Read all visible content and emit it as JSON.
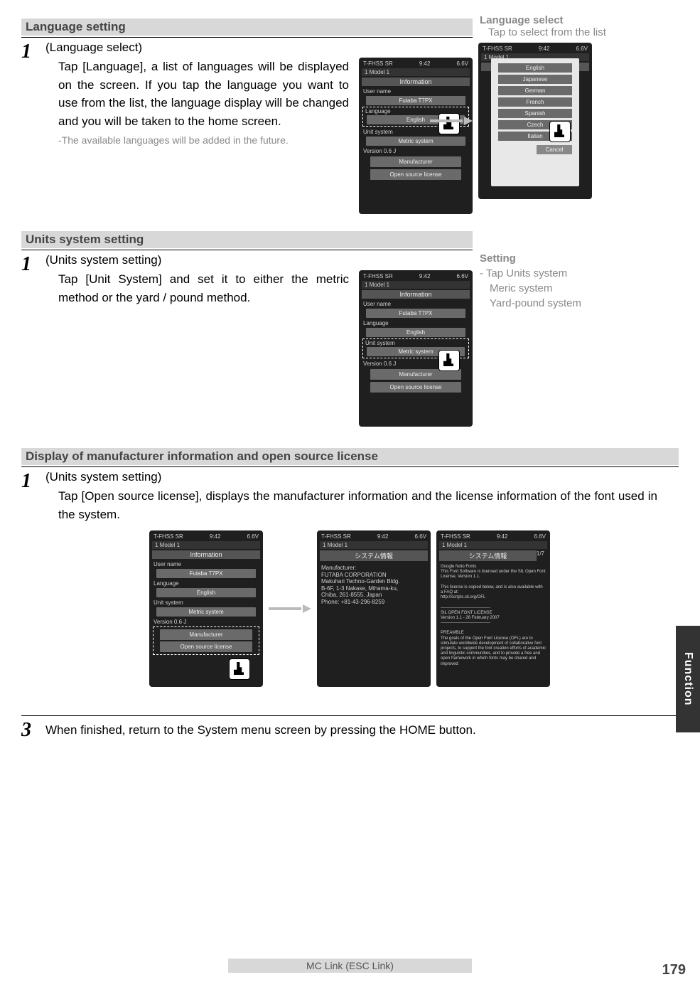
{
  "sections": {
    "lang_setting_heading": "Language setting",
    "units_setting_heading": "Units system setting",
    "manu_heading": "Display of manufacturer information and open source license"
  },
  "lang": {
    "step_num": "1",
    "step_title": "(Language select)",
    "step_text": "Tap [Language], a list of languages will be displayed on the screen. If you tap the language you want to use from the list, the language display will be changed and you will be taken to the home screen.",
    "step_note": "-The available languages will be added in the future.",
    "side_heading": "Language select",
    "side_sub": "Tap to select from the list"
  },
  "units": {
    "step_num": "1",
    "step_title": "(Units system setting)",
    "step_text": "Tap [Unit System] and set it to either the metric method or the yard / pound method.",
    "side_title": "Setting",
    "side_l1": "- Tap Units system",
    "side_l2": "Meric system",
    "side_l3": "Yard-pound system"
  },
  "manu": {
    "step_num": "1",
    "step_title": "(Units system setting)",
    "step_text": "Tap [Open source license], displays the manufacturer information and the license information of the font used in the system."
  },
  "final": {
    "step_num": "3",
    "step_text": "When finished, return to the System menu screen by pressing the HOME button."
  },
  "screen_common": {
    "status_left": "T-FHSS SR",
    "status_mid": "9:42",
    "status_right": "6.6V",
    "model": "1    Model 1",
    "info_title": "Information",
    "user_name_label": "User name",
    "user_name_value": "Futaba T7PX",
    "language_label": "Language",
    "language_value": "English",
    "unit_label": "Unit system",
    "unit_value": "Metric system",
    "version_label": "Version     0.6 J",
    "manufacturer_btn": "Manufacturer",
    "opensource_btn": "Open source license"
  },
  "lang_popup": {
    "options": [
      "English",
      "Japanese",
      "German",
      "French",
      "Spanish",
      "Czech",
      "Italian"
    ],
    "cancel": "Cancel"
  },
  "manu_screen": {
    "title_jp": "システム情報",
    "body": "Manufacturer:\nFUTABA CORPORATION\nMakuhari Techno-Garden Bldg.\nB-6F, 1-3 Nakase, Mihama-ku,\nChiba, 261-8555, Japan\nPhone: +81-43-296-8259"
  },
  "lic_screen": {
    "title_jp": "システム情報",
    "page": "1/7",
    "body": "Google Noto Fonts\nThis Font Software is licensed under the SIL Open Font License, Version 1.1.\n\nThis license is copied below, and is also available with a FAQ at:\nhttp://scripts.sil.org/OFL\n\n-----------------------------------\nSIL OPEN FONT LICENSE\nVersion 1.1 - 26 February 2007\n-----------------------------------\n\nPREAMBLE\nThe goals of the Open Font License (OFL) are to stimulate worldwide development of collaborative font projects, to support the font creation efforts of academic and linguistic communities, and to provide a free and open framework in which fonts may be shared and improved"
  },
  "footer": {
    "label": "MC Link  (ESC Link)",
    "page": "179",
    "tab": "Function"
  }
}
